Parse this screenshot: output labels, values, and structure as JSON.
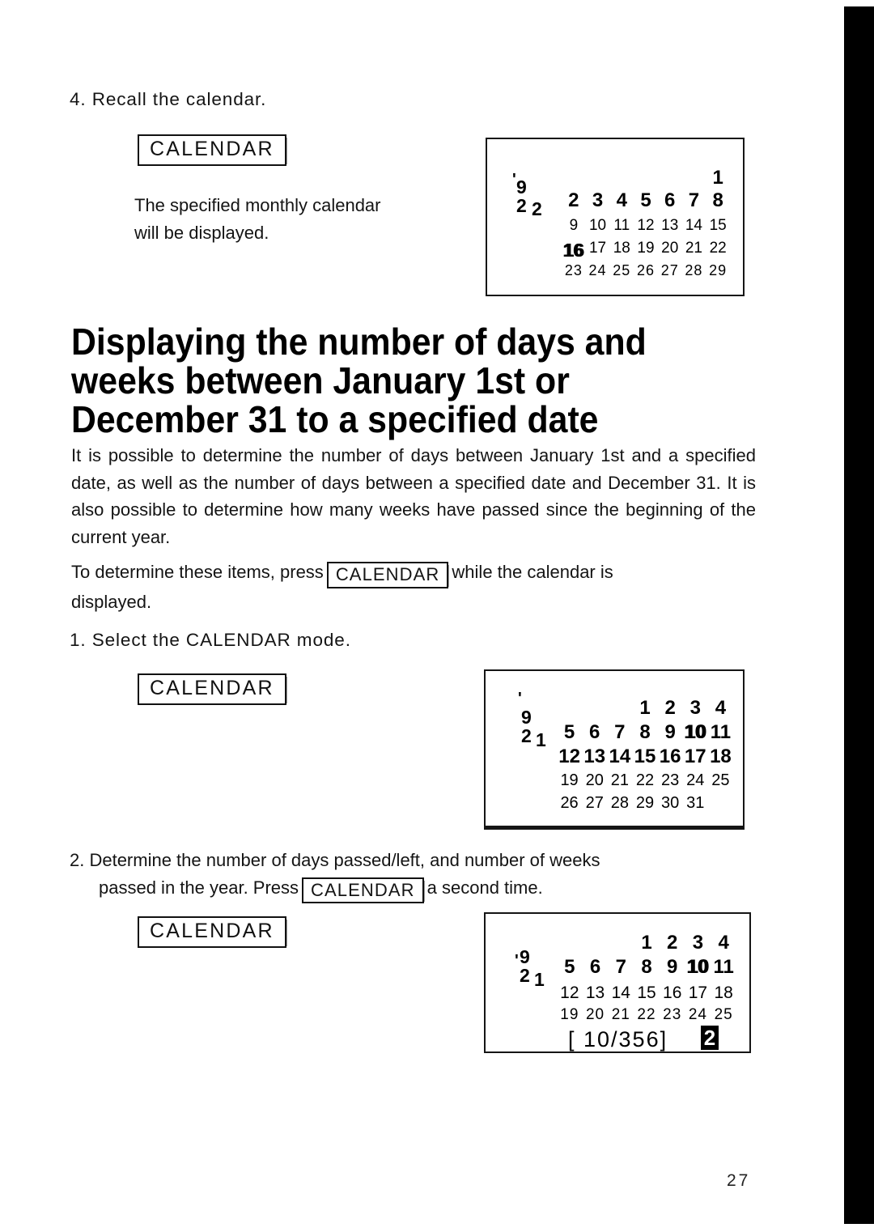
{
  "page": {
    "number": "27"
  },
  "step4": {
    "heading": "4. Recall the calendar.",
    "key_label": "CALENDAR",
    "description_line1": "The  specified  monthly  calendar",
    "description_line2": "will  be  displayed."
  },
  "headline": {
    "line1": "Displaying  the  number  of  days  and",
    "line2": "weeks   between   January   1st   or",
    "line3": "December 31 to a specified date"
  },
  "intro": {
    "paragraph": "It is possible to determine the number of days between January 1st and a specified date, as well as the number of days between a specified date and December 31. It is also possible to determine how many weeks have passed since the beginning of the current year.",
    "press_prefix": "To determine these items, press",
    "press_key": "CALENDAR",
    "press_suffix": "while the calendar is",
    "press_line2": "displayed."
  },
  "step1": {
    "heading": "1. Select  the  CALENDAR  mode.",
    "key_label": "CALENDAR"
  },
  "step2": {
    "line1": "2. Determine the number of days passed/left, and number of weeks",
    "line2_prefix": "passed in the year. Press",
    "line2_key": "CALENDAR",
    "line2_suffix": "a second time.",
    "key_label": "CALENDAR"
  },
  "lcd_feb": {
    "apostrophe": "'",
    "year": "9 2",
    "month": "2",
    "weeks": [
      [
        "",
        "",
        "",
        "",
        "",
        "",
        "1"
      ],
      [
        "2",
        "3",
        "4",
        "5",
        "6",
        "7",
        "8"
      ],
      [
        "9",
        "10",
        "11",
        "12",
        "13",
        "14",
        "15"
      ],
      [
        "16",
        "17",
        "18",
        "19",
        "20",
        "21",
        "22"
      ],
      [
        "23",
        "24",
        "25",
        "26",
        "27",
        "28",
        "29"
      ]
    ],
    "cursor_day": "16"
  },
  "lcd_jan": {
    "apostrophe": "'",
    "year": "9 2",
    "month": "1",
    "weeks": [
      [
        "",
        "",
        "",
        "1",
        "2",
        "3",
        "4"
      ],
      [
        "5",
        "6",
        "7",
        "8",
        "9",
        "10",
        "11"
      ],
      [
        "12",
        "13",
        "14",
        "15",
        "16",
        "17",
        "18"
      ],
      [
        "19",
        "20",
        "21",
        "22",
        "23",
        "24",
        "25"
      ],
      [
        "26",
        "27",
        "28",
        "29",
        "30",
        "31",
        ""
      ]
    ],
    "cursor_day": "10"
  },
  "lcd_jan_result": {
    "apostrophe": "'",
    "year": "9 2",
    "month": "1",
    "weeks": [
      [
        "",
        "",
        "",
        "1",
        "2",
        "3",
        "4"
      ],
      [
        "5",
        "6",
        "7",
        "8",
        "9",
        "10",
        "11"
      ],
      [
        "12",
        "13",
        "14",
        "15",
        "16",
        "17",
        "18"
      ],
      [
        "19",
        "20",
        "21",
        "22",
        "23",
        "24",
        "25"
      ]
    ],
    "cursor_day": "10",
    "readout": "[   10/356]",
    "week_badge": "2"
  }
}
